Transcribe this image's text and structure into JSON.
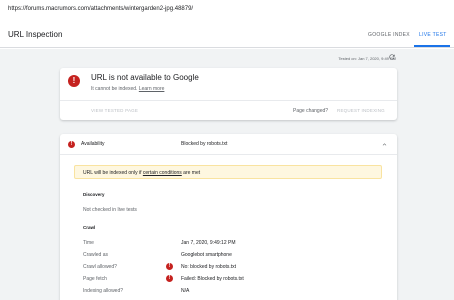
{
  "browser": {
    "url": "https://forums.macrumors.com/attachments/wintergarden2-jpg.48879/"
  },
  "header": {
    "title": "URL Inspection",
    "tabs": [
      {
        "label": "GOOGLE INDEX"
      },
      {
        "label": "LIVE TEST"
      }
    ]
  },
  "status": {
    "tested_on": "Tested on: Jan 7, 2020, 9:49 PM"
  },
  "summary_card": {
    "icon": "error-icon",
    "headline": "URL is not available to Google",
    "sub_text": "It cannot be indexed.",
    "learn_more": "Learn more",
    "view_tested_page": "VIEW TESTED PAGE",
    "page_changed": "Page changed?",
    "request_indexing": "REQUEST INDEXING"
  },
  "detail_card": {
    "availability_label": "Availability",
    "availability_value": "Blocked by robots.txt",
    "notice_pre": "URL will be indexed only if",
    "notice_link": "certain conditions",
    "notice_post": "are met",
    "discovery": {
      "title": "Discovery",
      "text": "Not checked in live tests"
    },
    "crawl": {
      "title": "Crawl",
      "rows": [
        {
          "key": "Time",
          "value": "Jan 7, 2020, 9:49:12 PM",
          "error": false
        },
        {
          "key": "Crawled as",
          "value": "Googlebot smartphone",
          "error": false
        },
        {
          "key": "Crawl allowed?",
          "value": "No: blocked by robots.txt",
          "error": true
        },
        {
          "key": "Page fetch",
          "value": "Failed: Blocked by robots.txt",
          "error": true
        },
        {
          "key": "Indexing allowed?",
          "value": "N/A",
          "error": false
        }
      ]
    }
  },
  "colors": {
    "accent": "#1a73e8",
    "error": "#c5221f",
    "notice_bg": "#fef7e0",
    "page_bg": "#f1f3f4"
  }
}
